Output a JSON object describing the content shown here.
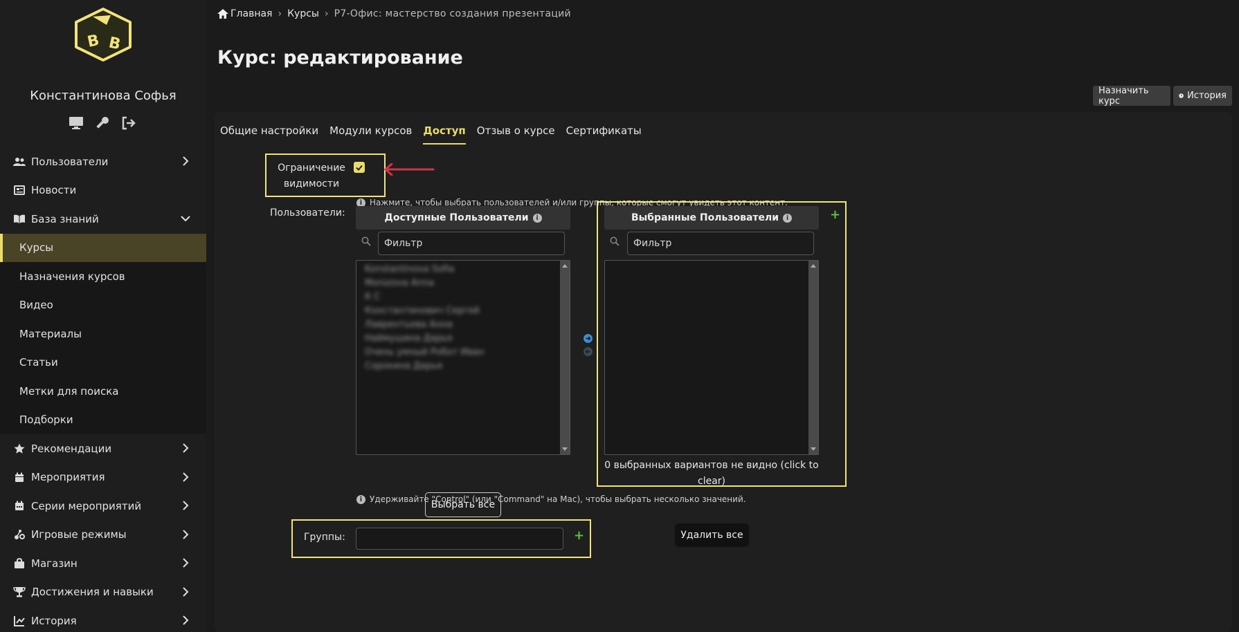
{
  "user": {
    "name": "Константинова Софья"
  },
  "nav": [
    {
      "label": "Пользователи",
      "icon": "users-icon",
      "has_chevron": true
    },
    {
      "label": "Новости",
      "icon": "newspaper-icon",
      "has_chevron": false
    },
    {
      "label": "База знаний",
      "icon": "book-icon",
      "has_chevron": true,
      "expanded": true
    },
    {
      "label": "Курсы",
      "sub": true,
      "active": true
    },
    {
      "label": "Назначения курсов",
      "sub": true
    },
    {
      "label": "Видео",
      "sub": true
    },
    {
      "label": "Материалы",
      "sub": true
    },
    {
      "label": "Статьи",
      "sub": true
    },
    {
      "label": "Метки для поиска",
      "sub": true
    },
    {
      "label": "Подборки",
      "sub": true
    },
    {
      "label": "Рекомендации",
      "icon": "star-icon",
      "has_chevron": true
    },
    {
      "label": "Мероприятия",
      "icon": "calendar-icon",
      "has_chevron": true
    },
    {
      "label": "Серии мероприятий",
      "icon": "calendar-series-icon",
      "has_chevron": true
    },
    {
      "label": "Игровые режимы",
      "icon": "gamepad-icon",
      "has_chevron": true
    },
    {
      "label": "Магазин",
      "icon": "bag-icon",
      "has_chevron": true
    },
    {
      "label": "Достижения и навыки",
      "icon": "trophy-icon",
      "has_chevron": true
    },
    {
      "label": "История",
      "icon": "chart-icon",
      "has_chevron": true
    }
  ],
  "breadcrumb": {
    "home": "Главная",
    "courses": "Курсы",
    "current": "Р7-Офис: мастерство создания презентаций"
  },
  "page_title": "Курс: редактирование",
  "toolbar": {
    "assign": "Назначить курс",
    "history": "История"
  },
  "tabs": [
    "Общие настройки",
    "Модули курсов",
    "Доступ",
    "Отзыв о курсе",
    "Сертификаты"
  ],
  "active_tab": "Доступ",
  "access": {
    "visibility_line1": "Ограничение",
    "visibility_line2": "видимости",
    "visibility_checked": true,
    "visibility_help": "Нажмите, чтобы выбрать пользователей и/или группы, которые смогут увидеть этот контент.",
    "users_label": "Пользователи:",
    "available_title": "Доступные Пользователи",
    "selected_title": "Выбранные Пользователи",
    "filter_placeholder": "Фильтр",
    "available_users": [
      "Konstantinova Sofia",
      "Morozova Anna",
      "К С",
      "Константинович Сергей",
      "Лаврентьева Анна",
      "Наймушина Дарья",
      "Очень умный Робот Иван",
      "Сорокина Дарья"
    ],
    "select_all": "Выбрать все",
    "hidden_selected": "0 выбранных вариантов не видно (click to clear)",
    "remove_all": "Удалить все",
    "multi_help": "Удерживайте \"Control\" (или \"Command\" на Mac), чтобы выбрать несколько значений.",
    "groups_label": "Группы:"
  },
  "colors": {
    "accent": "#e9dc6a",
    "highlight_box": "#f1e47a",
    "arrow": "#d9304a",
    "plus": "#5fc23c"
  }
}
